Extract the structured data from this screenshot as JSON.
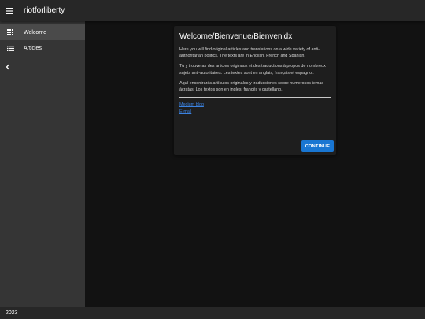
{
  "header": {
    "title": "riotforliberty",
    "menu_icon": "hamburger-menu-icon"
  },
  "sidebar": {
    "items": [
      {
        "label": "Welcome",
        "icon": "grid-view-icon",
        "active": true
      },
      {
        "label": "Articles",
        "icon": "list-icon",
        "active": false
      }
    ],
    "collapse_icon": "chevron-left-icon"
  },
  "dialog": {
    "title": "Welcome/Bienvenue/Bienvenidx",
    "paragraphs": [
      "Here you will find original articles and translations on a wide variety of anti-authoritarian politics. The texts are in English, French and Spanish.",
      "Tu y trouveras des articles originaux et des traductions à propos de nombreux sujets anti-autoritaires. Les textes sont en anglais, français et espagnol.",
      "Aquí encontrarás artículos originales y traducciones sobre numerosos temas ácratas. Los textos son en inglés, francés y castellano."
    ],
    "links": [
      {
        "label": "Medium blog"
      },
      {
        "label": "E-mail"
      }
    ],
    "continue_label": "CONTINUE"
  },
  "footer": {
    "text": "2023"
  },
  "colors": {
    "topbar": "#272727",
    "sidebar": "#353535",
    "active_item": "#4a4a4a",
    "background": "#121212",
    "card": "#1e1e1e",
    "accent": "#1976d2",
    "link": "#3b82e0"
  }
}
